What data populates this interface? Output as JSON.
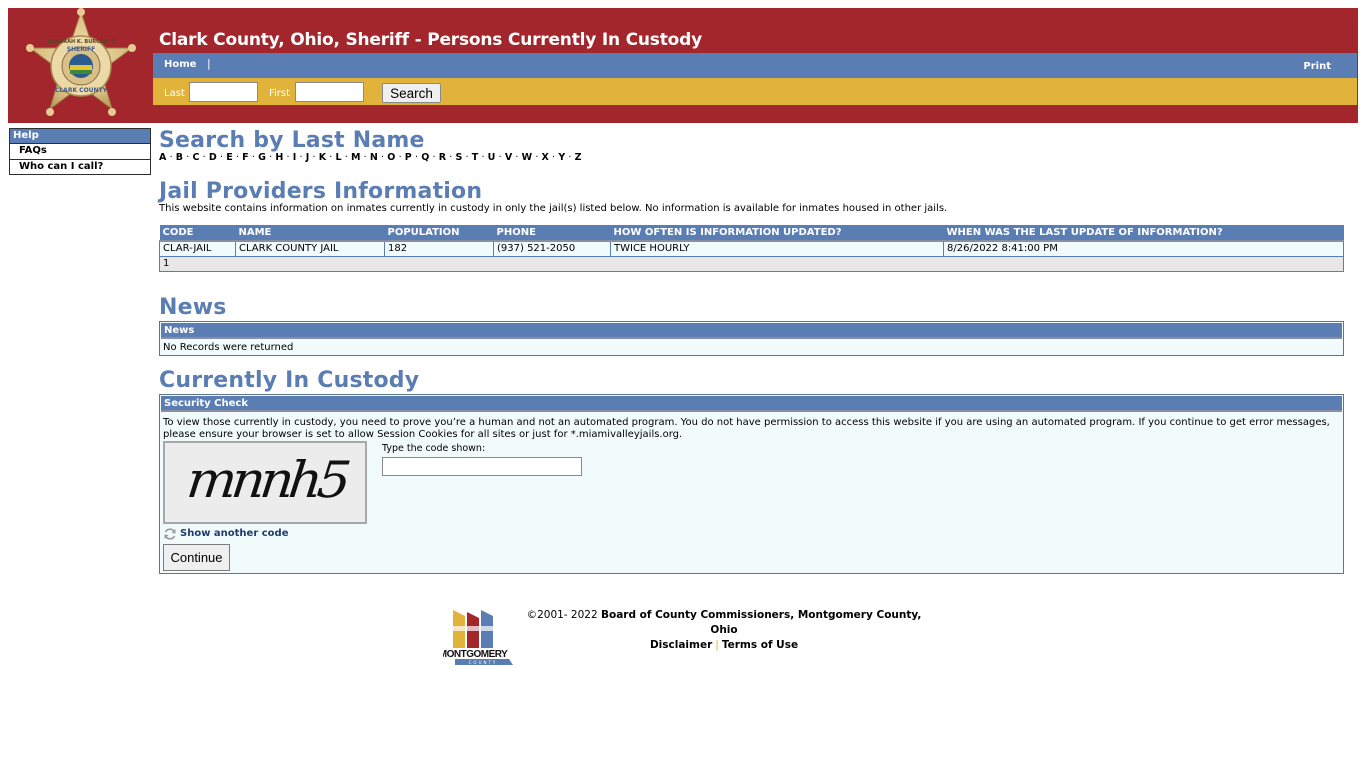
{
  "header": {
    "title": "Clark County, Ohio, Sheriff - Persons Currently In Custody",
    "logo_alt": "Clark County Sheriff badge",
    "badge_top_text": "DEBORAH K. BURCHETT",
    "badge_mid_text": "SHERIFF",
    "badge_bottom_text": "CLARK COUNTY",
    "colors": {
      "red": "#a3262d",
      "blue": "#5a7db3",
      "gold": "#e2b33a"
    }
  },
  "nav": {
    "home_label": "Home",
    "separator": "|",
    "print_label": "Print"
  },
  "search": {
    "last_label": "Last",
    "last_value": "",
    "first_label": "First",
    "first_value": "",
    "button_label": "Search"
  },
  "sidebar": {
    "header": "Help",
    "items": [
      {
        "label": "FAQs"
      },
      {
        "label": "Who can I call?"
      }
    ]
  },
  "search_by_name": {
    "title": "Search by Last Name",
    "letters": [
      "A",
      "B",
      "C",
      "D",
      "E",
      "F",
      "G",
      "H",
      "I",
      "J",
      "K",
      "L",
      "M",
      "N",
      "O",
      "P",
      "Q",
      "R",
      "S",
      "T",
      "U",
      "V",
      "W",
      "X",
      "Y",
      "Z"
    ]
  },
  "jail_providers": {
    "title": "Jail Providers Information",
    "description": "This website contains information on inmates currently in custody in only the jail(s) listed below. No information is available for inmates housed in other jails.",
    "columns": [
      "CODE",
      "NAME",
      "POPULATION",
      "PHONE",
      "HOW OFTEN IS INFORMATION UPDATED?",
      "WHEN WAS THE LAST UPDATE OF INFORMATION?"
    ],
    "rows": [
      [
        "CLAR-JAIL",
        "CLARK COUNTY JAIL",
        "182",
        "(937) 521-2050",
        "TWICE HOURLY",
        "8/26/2022 8:41:00 PM"
      ]
    ],
    "pager": "1"
  },
  "news": {
    "title": "News",
    "box_header": "News",
    "message": "No Records were returned"
  },
  "custody": {
    "title": "Currently In Custody",
    "box_header": "Security Check",
    "message": "To view those currently in custody, you need to prove you’re a human and not an automated program. You do not have permission to access this website if you are using an automated program. If you continue to get error messages, please ensure your browser is set to allow Session Cookies for all sites or just for *.miamivalleyjails.org.",
    "captcha_text": "mnnh5",
    "code_label": "Type the code shown:",
    "code_value": "",
    "another_code_label": "Show another code",
    "continue_label": "Continue"
  },
  "footer": {
    "copyright": "©2001- 2022",
    "owner": "Board of County Commissioners, Montgomery County, Ohio",
    "disclaimer_label": "Disclaimer",
    "separator": "|",
    "terms_label": "Terms of Use",
    "logo_text": "MONTGOMERY",
    "logo_subtext": "COUNTY"
  }
}
